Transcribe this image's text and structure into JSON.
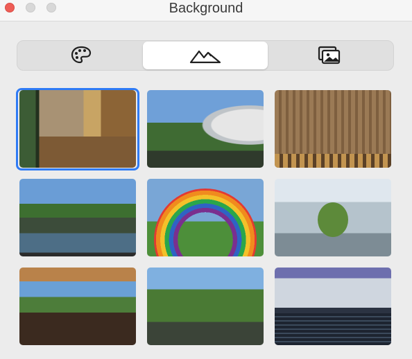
{
  "window": {
    "title": "Background",
    "controls": {
      "close": "close",
      "minimize": "minimize",
      "zoom": "zoom"
    }
  },
  "segmented_control": {
    "segments": [
      {
        "icon": "palette-icon",
        "selected": false
      },
      {
        "icon": "mountains-icon",
        "selected": true
      },
      {
        "icon": "photos-icon",
        "selected": false
      }
    ]
  },
  "thumbnails": [
    {
      "name": "curved-wood-interior",
      "selected": true
    },
    {
      "name": "ring-building-exterior",
      "selected": false
    },
    {
      "name": "wood-slat-wall",
      "selected": false
    },
    {
      "name": "pond-with-trees",
      "selected": false
    },
    {
      "name": "rainbow-arch",
      "selected": false
    },
    {
      "name": "atrium-with-trees",
      "selected": false
    },
    {
      "name": "wood-canopy-walkway",
      "selected": false
    },
    {
      "name": "forest-path",
      "selected": false
    },
    {
      "name": "theater-entrance",
      "selected": false
    }
  ],
  "colors": {
    "accent": "#2f7bf5",
    "close": "#ee5d56"
  }
}
